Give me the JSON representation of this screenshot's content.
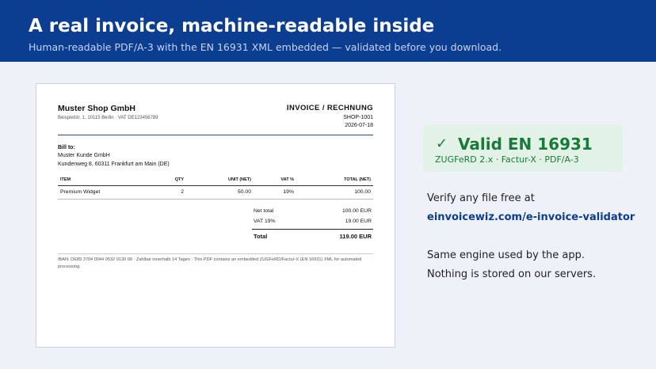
{
  "hero": {
    "title": "A real invoice, machine-readable inside",
    "subtitle": "Human-readable PDF/A-3 with the EN 16931 XML embedded — validated before you download."
  },
  "invoice": {
    "seller": {
      "name": "Muster Shop GmbH",
      "address": "Beispielstr. 1, 10115 Berlin · VAT DE123456789"
    },
    "doc_title": "INVOICE / RECHNUNG",
    "number": "SHOP-1001",
    "date": "2026-07-18",
    "bill_to": {
      "label": "Bill to:",
      "name": "Muster Kunde GmbH",
      "address": "Kundenweg 8, 60311 Frankfurt am Main (DE)"
    },
    "columns": {
      "item": "ITEM",
      "qty": "QTY",
      "unit": "UNIT (NET)",
      "vat": "VAT %",
      "total": "TOTAL (NET)"
    },
    "lines": [
      {
        "item": "Premium Widget",
        "qty": "2",
        "unit": "50.00",
        "vat": "19%",
        "total": "100.00"
      }
    ],
    "totals": {
      "net_label": "Net total",
      "net_value": "100.00 EUR",
      "vat_label": "VAT 19%",
      "vat_value": "19.00 EUR",
      "grand_label": "Total",
      "grand_value": "119.00 EUR"
    },
    "footer": "IBAN: DE89 3704 0044 0532 0130 00 · Zahlbar innerhalb 14 Tagen · This PDF contains an embedded ZUGFeRD/Factur-X (EN 16931) XML for automated processing."
  },
  "validation": {
    "check_icon": "✓",
    "title": "Valid EN 16931",
    "subtitle": "ZUGFeRD 2.x · Factur-X · PDF/A-3",
    "color": "#1a7a3a",
    "background": "#e3f2e7"
  },
  "verify": {
    "text": "Verify any file free at",
    "link": "einvoicewiz.com/e-invoice-validator"
  },
  "notes": {
    "line1": "Same engine used by the app.",
    "line2": "Nothing is stored on our servers."
  },
  "colors": {
    "brand": "#0b3d91",
    "page_background": "#eef1f8"
  }
}
